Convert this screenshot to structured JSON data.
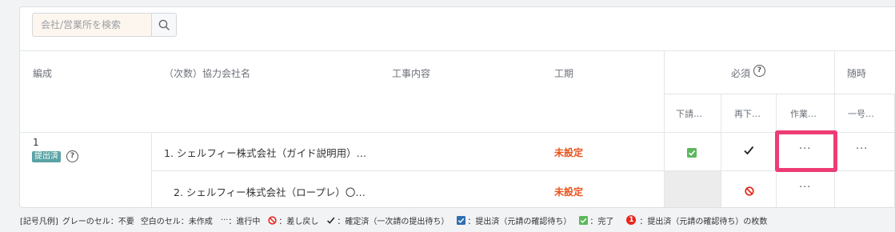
{
  "search": {
    "placeholder": "会社/営業所を検索"
  },
  "table": {
    "headers": {
      "composition": "編成",
      "company": "（次数）協力会社名",
      "work": "工事内容",
      "period": "工期",
      "required": "必須",
      "optional": "随時"
    },
    "subheaders": [
      "下請…",
      "再下…",
      "作業…",
      "一号…"
    ],
    "group": {
      "number": "1",
      "badge": "提出済"
    },
    "rows": [
      {
        "company": "1. シェルフィー株式会社（ガイド説明用）…",
        "period": "未設定"
      },
      {
        "company": "2. シェルフィー株式会社（ロープレ）〇…",
        "period": "未設定"
      }
    ],
    "dots": "···"
  },
  "legend": {
    "prefix": "[記号凡例]",
    "grey": "グレーのセル：不要",
    "blank": "空白のセル：未作成",
    "dots_symbol": "···",
    "in_progress": "：進行中",
    "rejected": "：差し戻し",
    "confirmed": "：確定済（一次請の提出待ち）",
    "submitted": "：提出済（元請の確認待ち）",
    "complete": "：完了",
    "count_symbol": "1",
    "count": "：提出済（元請の確認待ち）の枚数"
  },
  "colors": {
    "accent_red": "#e8541c",
    "highlight": "#ee3c74",
    "badge": "#5aa3a5",
    "check_green": "#5cb85c",
    "submitted_blue": "#2f6fb0"
  }
}
